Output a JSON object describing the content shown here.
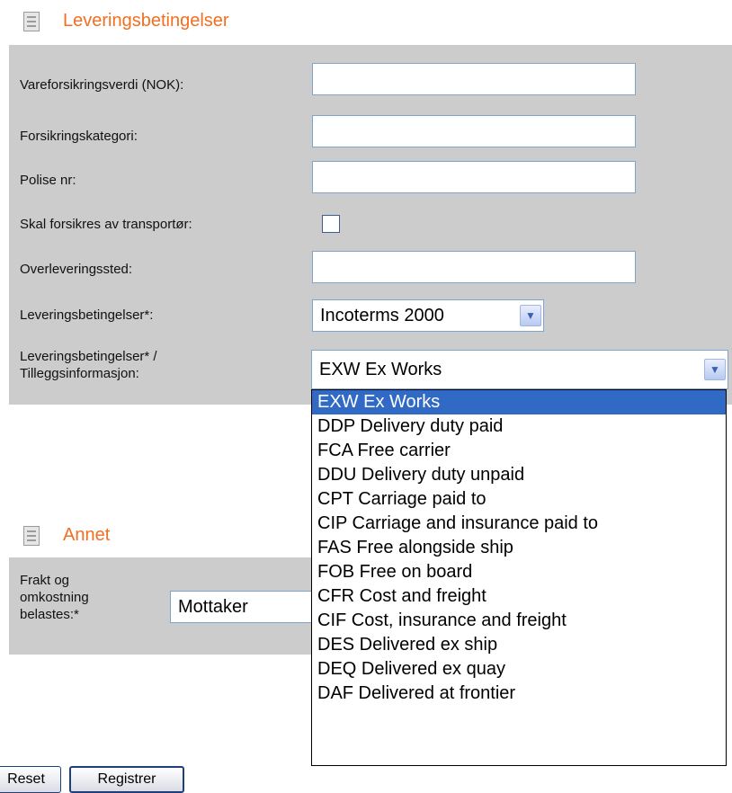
{
  "sections": {
    "delivery_title": "Leveringsbetingelser",
    "other_title": "Annet"
  },
  "form": {
    "insurance_value_label": "Vareforsikringsverdi (NOK):",
    "insurance_category_label": "Forsikringskategori:",
    "policy_no_label": "Polise nr:",
    "insured_by_carrier_label": "Skal forsikres av transportør:",
    "handover_place_label": "Overleveringssted:",
    "delivery_terms_label": "Leveringsbetingelser*:",
    "delivery_terms_value": "Incoterms 2000",
    "delivery_info_label_line1": "Leveringsbetingelser* /",
    "delivery_info_label_line2": "Tilleggsinformasjon:",
    "delivery_info_value": "EXW Ex Works"
  },
  "dropdown": {
    "options": [
      "EXW Ex Works",
      "DDP Delivery duty paid",
      "FCA Free carrier",
      "DDU Delivery duty unpaid",
      "CPT Carriage paid to",
      "CIP Carriage and insurance paid to",
      "FAS Free alongside ship",
      "FOB Free on board",
      "CFR Cost and freight",
      "CIF Cost, insurance and freight",
      "DES Delivered ex ship",
      "DEQ Delivered ex quay",
      "DAF Delivered at frontier"
    ]
  },
  "other": {
    "freight_label_line1": "Frakt og",
    "freight_label_line2": "omkostning",
    "freight_label_line3": "belastes:*",
    "freight_value": "Mottaker"
  },
  "buttons": {
    "reset_label": "Reset",
    "submit_label": "Registrer"
  },
  "colors": {
    "accent": "#f26f21",
    "panel": "#cccccc",
    "selection": "#316ac5"
  }
}
